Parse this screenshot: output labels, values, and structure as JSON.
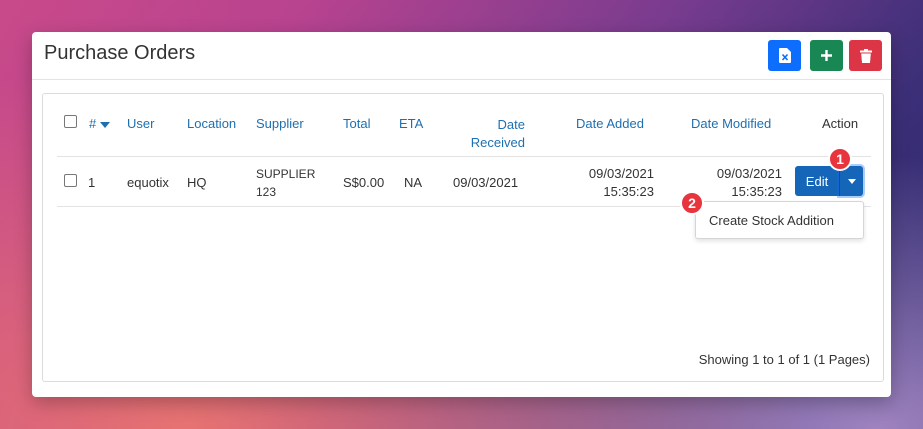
{
  "header": {
    "title": "Purchase Orders",
    "buttons": [
      {
        "name": "export-excel",
        "icon": "file-excel-icon",
        "color": "#0d6efd"
      },
      {
        "name": "add",
        "icon": "plus-icon",
        "color": "#198754"
      },
      {
        "name": "delete",
        "icon": "trash-icon",
        "color": "#dc3545"
      }
    ]
  },
  "table": {
    "columns": {
      "number": "#",
      "user": "User",
      "location": "Location",
      "supplier": "Supplier",
      "total": "Total",
      "eta": "ETA",
      "date_received_1": "Date",
      "date_received_2": "Received",
      "date_added": "Date Added",
      "date_modified": "Date Modified",
      "action": "Action"
    },
    "rows": [
      {
        "number": "1",
        "user": "equotix",
        "location": "HQ",
        "supplier_1": "SUPPLIER",
        "supplier_2": "123",
        "total": "S$0.00",
        "eta": "NA",
        "date_received": "09/03/2021",
        "date_added_1": "09/03/2021",
        "date_added_2": "15:35:23",
        "date_modified_1": "09/03/2021",
        "date_modified_2": "15:35:23",
        "edit_label": "Edit"
      }
    ]
  },
  "dropdown": {
    "items": [
      "Create Stock Addition"
    ]
  },
  "pagination": {
    "summary": "Showing 1 to 1 of 1 (1 Pages)"
  },
  "annotations": {
    "badge_1": "1",
    "badge_2": "2"
  }
}
